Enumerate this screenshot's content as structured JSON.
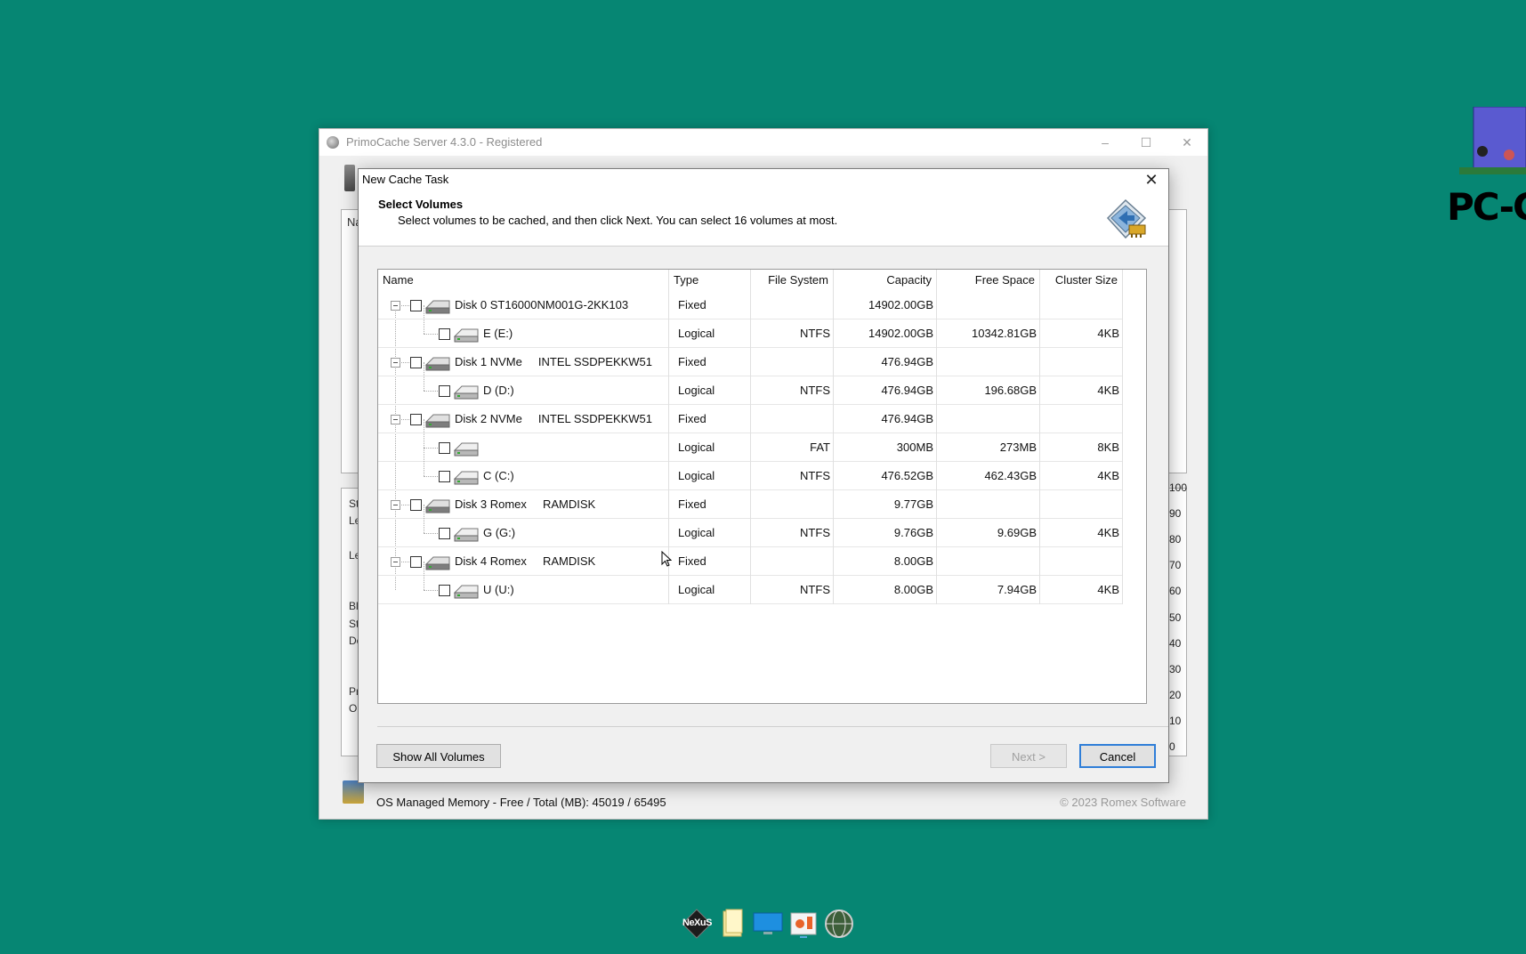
{
  "main_window": {
    "title": "PrimoCache Server 4.3.0 - Registered",
    "minimize": "–",
    "maximize": "☐",
    "close": "✕",
    "panel_label": "Na",
    "side_labels": [
      "St",
      "Le",
      "Le",
      "Bl",
      "St",
      "De",
      "Pr",
      "O"
    ],
    "axis_ticks": [
      "100",
      "90",
      "80",
      "70",
      "60",
      "50",
      "40",
      "30",
      "20",
      "10",
      "0"
    ],
    "memory_text": "OS Managed Memory - Free / Total (MB):  45019 / 65495",
    "copyright": "© 2023 Romex Software"
  },
  "dialog": {
    "title": "New Cache Task",
    "close": "✕",
    "header_title": "Select Volumes",
    "header_desc": "Select volumes to be cached, and then click Next. You can select 16 volumes at most.",
    "columns": [
      "Name",
      "Type",
      "File System",
      "Capacity",
      "Free Space",
      "Cluster Size"
    ],
    "rows": [
      {
        "level": 0,
        "name": "Disk 0 ST16000NM001G-2KK103",
        "type": "Fixed",
        "fs": "",
        "capacity": "14902.00GB",
        "free": "",
        "cluster": "",
        "checked": false
      },
      {
        "level": 1,
        "name": "E (E:)",
        "type": "Logical",
        "fs": "NTFS",
        "capacity": "14902.00GB",
        "free": "10342.81GB",
        "cluster": "4KB",
        "checked": false
      },
      {
        "level": 0,
        "name": "Disk 1 NVMe     INTEL SSDPEKKW51",
        "type": "Fixed",
        "fs": "",
        "capacity": "476.94GB",
        "free": "",
        "cluster": "",
        "checked": false
      },
      {
        "level": 1,
        "name": "D (D:)",
        "type": "Logical",
        "fs": "NTFS",
        "capacity": "476.94GB",
        "free": "196.68GB",
        "cluster": "4KB",
        "checked": false
      },
      {
        "level": 0,
        "name": "Disk 2 NVMe     INTEL SSDPEKKW51",
        "type": "Fixed",
        "fs": "",
        "capacity": "476.94GB",
        "free": "",
        "cluster": "",
        "checked": false
      },
      {
        "level": 1,
        "name": "",
        "type": "Logical",
        "fs": "FAT",
        "capacity": "300MB",
        "free": "273MB",
        "cluster": "8KB",
        "checked": false
      },
      {
        "level": 1,
        "name": "C (C:)",
        "type": "Logical",
        "fs": "NTFS",
        "capacity": "476.52GB",
        "free": "462.43GB",
        "cluster": "4KB",
        "checked": false
      },
      {
        "level": 0,
        "name": "Disk 3 Romex     RAMDISK",
        "type": "Fixed",
        "fs": "",
        "capacity": "9.77GB",
        "free": "",
        "cluster": "",
        "checked": false
      },
      {
        "level": 1,
        "name": "G (G:)",
        "type": "Logical",
        "fs": "NTFS",
        "capacity": "9.76GB",
        "free": "9.69GB",
        "cluster": "4KB",
        "checked": false
      },
      {
        "level": 0,
        "name": "Disk 4 Romex     RAMDISK",
        "type": "Fixed",
        "fs": "",
        "capacity": "8.00GB",
        "free": "",
        "cluster": "",
        "checked": false
      },
      {
        "level": 1,
        "name": "U (U:)",
        "type": "Logical",
        "fs": "NTFS",
        "capacity": "8.00GB",
        "free": "7.94GB",
        "cluster": "4KB",
        "checked": false
      }
    ],
    "buttons": {
      "show_all": "Show All Volumes",
      "next": "Next >",
      "cancel": "Cancel"
    }
  },
  "dock": {
    "items": [
      "nexus-icon",
      "file-explorer-icon",
      "monitor-icon",
      "paint-icon",
      "globe-icon"
    ],
    "nexus_label": "NeXuS"
  },
  "corner_logo": {
    "text": "PC-CE"
  },
  "colors": {
    "desktop": "#068673",
    "accent": "#2f7ed8"
  }
}
